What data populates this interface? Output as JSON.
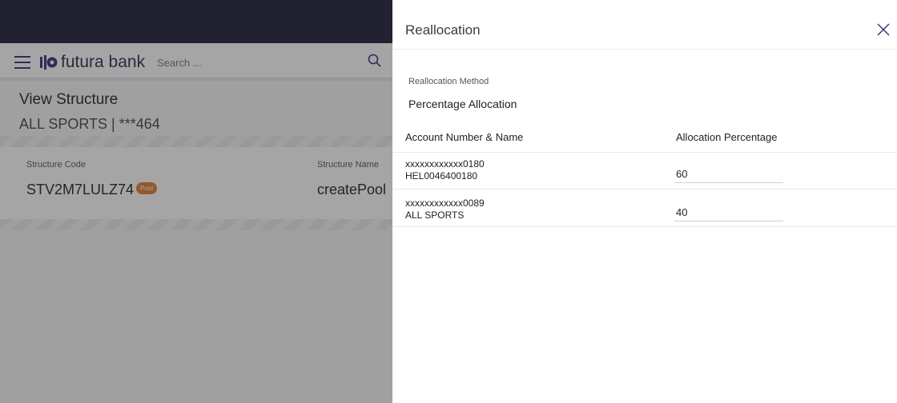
{
  "app": {
    "brand": "futura bank",
    "search": {
      "placeholder": "Search ..."
    },
    "page_title": "View Structure",
    "page_subtitle": "ALL SPORTS | ***464",
    "fields": {
      "structure_code_label": "Structure Code",
      "structure_code_value": "STV2M7LULZ74",
      "pool_badge": "Pool",
      "structure_name_label": "Structure Name",
      "structure_name_value": "createPool"
    }
  },
  "drawer": {
    "title": "Reallocation",
    "method_label": "Reallocation Method",
    "method_value": "Percentage Allocation",
    "table": {
      "columns": [
        "Account Number & Name",
        "Allocation Percentage"
      ],
      "rows": [
        {
          "account_number": "xxxxxxxxxxxx0180",
          "account_name": "HEL0046400180",
          "allocation": "60"
        },
        {
          "account_number": "xxxxxxxxxxxx0089",
          "account_name": "ALL SPORTS",
          "allocation": "40"
        }
      ]
    }
  },
  "colors": {
    "topbar": "#1d1d3a",
    "brand": "#3a2f7d",
    "pool_badge": "#e07b2d",
    "overlay": "rgba(40,40,40,0.42)"
  },
  "icons": [
    "hamburger-icon",
    "futura-logo-icon",
    "search-icon",
    "close-icon"
  ]
}
